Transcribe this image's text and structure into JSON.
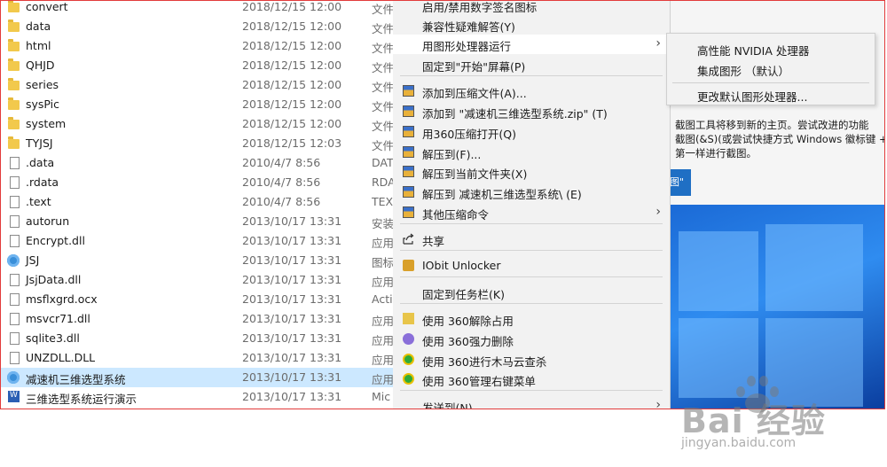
{
  "files": [
    {
      "name": "convert",
      "date": "2018/12/15 12:00",
      "type": "文件",
      "icon": "folder-icon"
    },
    {
      "name": "data",
      "date": "2018/12/15 12:00",
      "type": "文件",
      "icon": "folder-icon"
    },
    {
      "name": "html",
      "date": "2018/12/15 12:00",
      "type": "文件",
      "icon": "folder-icon"
    },
    {
      "name": "QHJD",
      "date": "2018/12/15 12:00",
      "type": "文件",
      "icon": "folder-icon"
    },
    {
      "name": "series",
      "date": "2018/12/15 12:00",
      "type": "文件",
      "icon": "folder-icon"
    },
    {
      "name": "sysPic",
      "date": "2018/12/15 12:00",
      "type": "文件",
      "icon": "folder-icon"
    },
    {
      "name": "system",
      "date": "2018/12/15 12:00",
      "type": "文件",
      "icon": "folder-icon"
    },
    {
      "name": "TYJSJ",
      "date": "2018/12/15 12:03",
      "type": "文件",
      "icon": "folder-icon"
    },
    {
      "name": ".data",
      "date": "2010/4/7 8:56",
      "type": "DAT",
      "icon": "document-icon"
    },
    {
      "name": ".rdata",
      "date": "2010/4/7 8:56",
      "type": "RDA",
      "icon": "document-icon"
    },
    {
      "name": ".text",
      "date": "2010/4/7 8:56",
      "type": "TEX",
      "icon": "document-icon"
    },
    {
      "name": "autorun",
      "date": "2013/10/17 13:31",
      "type": "安装",
      "icon": "gear-document-icon"
    },
    {
      "name": "Encrypt.dll",
      "date": "2013/10/17 13:31",
      "type": "应用",
      "icon": "dll-icon"
    },
    {
      "name": "JSJ",
      "date": "2013/10/17 13:31",
      "type": "图标",
      "icon": "gear-icon"
    },
    {
      "name": "JsjData.dll",
      "date": "2013/10/17 13:31",
      "type": "应用",
      "icon": "dll-icon"
    },
    {
      "name": "msflxgrd.ocx",
      "date": "2013/10/17 13:31",
      "type": "Acti",
      "icon": "dll-icon"
    },
    {
      "name": "msvcr71.dll",
      "date": "2013/10/17 13:31",
      "type": "应用",
      "icon": "dll-icon"
    },
    {
      "name": "sqlite3.dll",
      "date": "2013/10/17 13:31",
      "type": "应用",
      "icon": "dll-icon"
    },
    {
      "name": "UNZDLL.DLL",
      "date": "2013/10/17 13:31",
      "type": "应用",
      "icon": "dll-icon"
    },
    {
      "name": "减速机三维选型系统",
      "date": "2013/10/17 13:31",
      "type": "应用",
      "icon": "gear-icon"
    },
    {
      "name": "三维选型系统运行演示",
      "date": "2013/10/17 13:31",
      "type": "Mic",
      "icon": "word-icon"
    }
  ],
  "context_menu": {
    "items": [
      {
        "label": "启用/禁用数字签名图标",
        "icon": ""
      },
      {
        "label": "兼容性疑难解答(Y)",
        "icon": ""
      },
      {
        "label": "用图形处理器运行",
        "icon": "",
        "submenu": true
      },
      {
        "label": "固定到\"开始\"屏幕(P)",
        "icon": ""
      },
      {
        "label": "添加到压缩文件(A)...",
        "icon": "zip-icon"
      },
      {
        "label": "添加到 \"减速机三维选型系统.zip\" (T)",
        "icon": "zip-icon"
      },
      {
        "label": "用360压缩打开(Q)",
        "icon": "zip-icon"
      },
      {
        "label": "解压到(F)...",
        "icon": "zip-icon"
      },
      {
        "label": "解压到当前文件夹(X)",
        "icon": "zip-icon"
      },
      {
        "label": "解压到 减速机三维选型系统\\ (E)",
        "icon": "zip-icon"
      },
      {
        "label": "其他压缩命令",
        "icon": "zip-icon",
        "submenu": true
      },
      {
        "label": "共享",
        "icon": "share-icon"
      },
      {
        "label": "IObit Unlocker",
        "icon": "lock-icon"
      },
      {
        "label": "固定到任务栏(K)",
        "icon": ""
      },
      {
        "label": "使用 360解除占用",
        "icon": "360-unlock-icon"
      },
      {
        "label": "使用 360强力删除",
        "icon": "360-delete-icon"
      },
      {
        "label": "使用 360进行木马云查杀",
        "icon": "360-scan-icon"
      },
      {
        "label": "使用 360管理右键菜单",
        "icon": "360-menu-icon"
      },
      {
        "label": "发送到(N)",
        "icon": "",
        "submenu": true
      }
    ]
  },
  "submenu": {
    "items": [
      "高性能 NVIDIA 处理器",
      "集成图形 （默认）",
      "更改默认图形处理器..."
    ]
  },
  "background_window": {
    "text_lines": [
      "截图工具将移到新的主页。尝试改进的功能",
      "截图(&S)(或尝试快捷方式 Windows 徽标键 +",
      "第一样进行截图。"
    ],
    "button_label": "图\""
  },
  "watermark": {
    "logo": "Bai  经验",
    "url": "jingyan.baidu.com"
  },
  "colors": {
    "frame": "#e23b3b",
    "selected_row": "#cce8ff",
    "menu_bg": "#f2f2f2",
    "desktop_blue": "#1b6ad6"
  }
}
